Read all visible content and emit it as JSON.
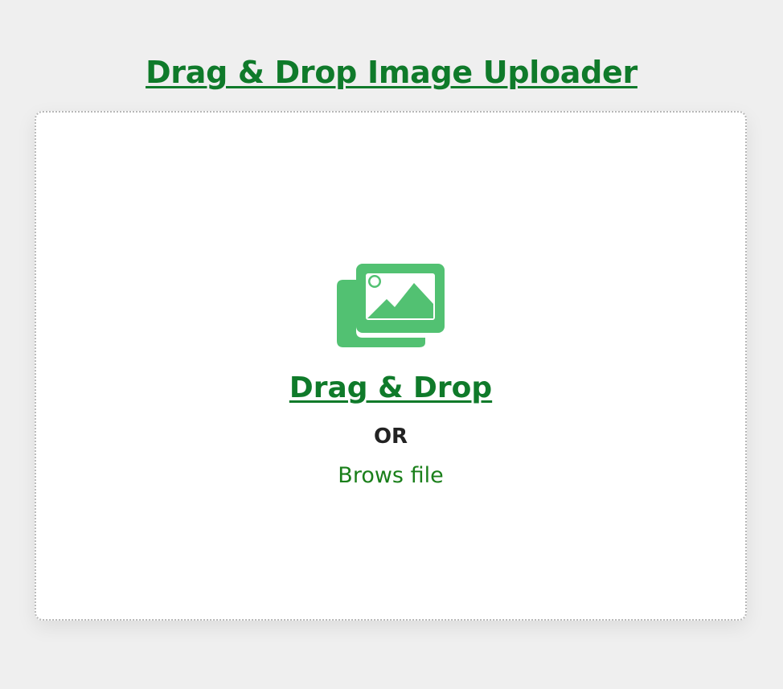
{
  "page": {
    "title": "Drag & Drop Image Uploader"
  },
  "dropzone": {
    "icon": "images-icon",
    "heading": "Drag & Drop",
    "or_label": "OR",
    "browse_label": "Brows file"
  },
  "colors": {
    "background": "#efefef",
    "accent": "#0f7a2a",
    "icon_green": "#52c172",
    "text_dark": "#222222"
  }
}
